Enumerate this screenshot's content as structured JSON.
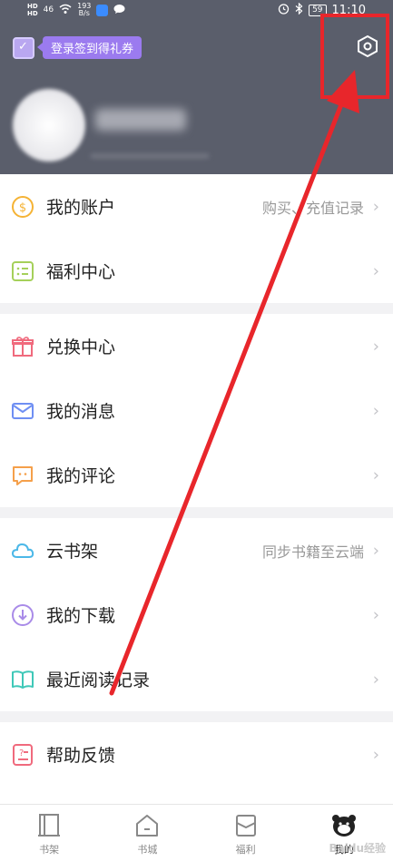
{
  "status_bar": {
    "hd1": "HD",
    "hd2": "HD",
    "signal": "46",
    "speed_value": "193",
    "speed_unit": "B/s",
    "battery": "59",
    "time": "11:10"
  },
  "header": {
    "checkin_label": "登录签到得礼券"
  },
  "menu": {
    "account": {
      "label": "我的账户",
      "right": "购买、充值记录"
    },
    "welfare": {
      "label": "福利中心"
    },
    "exchange": {
      "label": "兑换中心"
    },
    "messages": {
      "label": "我的消息"
    },
    "comments": {
      "label": "我的评论"
    },
    "cloud_shelf": {
      "label": "云书架",
      "right": "同步书籍至云端"
    },
    "downloads": {
      "label": "我的下载"
    },
    "recent": {
      "label": "最近阅读记录"
    },
    "help": {
      "label": "帮助反馈"
    }
  },
  "tabbar": {
    "bookshelf": "书架",
    "bookstore": "书城",
    "welfare": "福利",
    "mine": "我的"
  },
  "watermark": "Baidu经验",
  "colors": {
    "header_bg": "#5a5e6b",
    "checkin_purple": "#9b7bef",
    "annotation_red": "#e8262b"
  }
}
